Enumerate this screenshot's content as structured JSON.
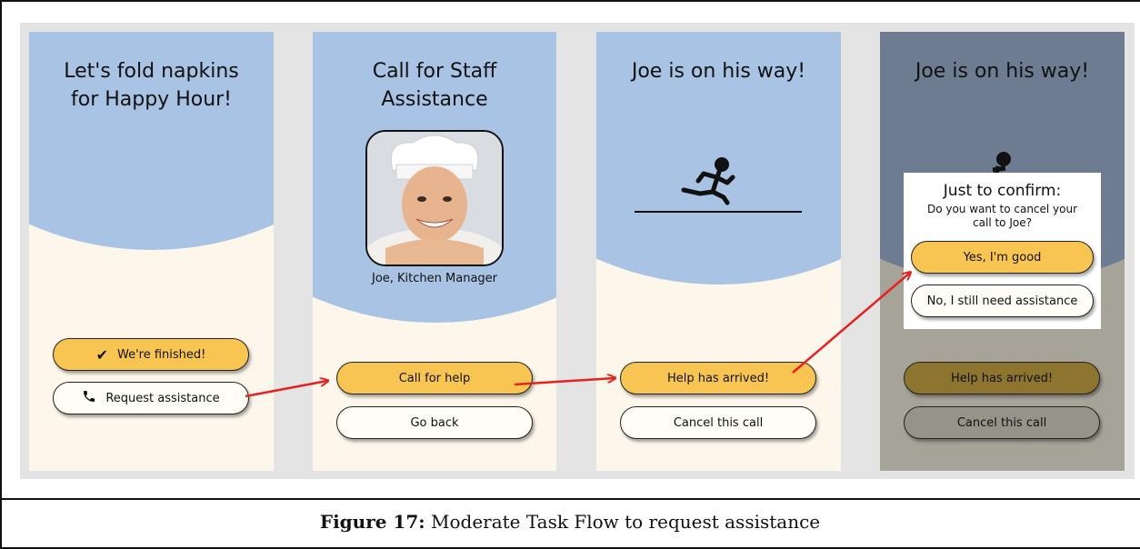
{
  "caption": {
    "label": "Figure 17:",
    "text": "Moderate Task Flow to request assistance"
  },
  "screen1": {
    "title_line1": "Let's fold napkins",
    "title_line2": "for Happy Hour!",
    "finished_label": "We're finished!",
    "request_label": "Request assistance"
  },
  "screen2": {
    "title_line1": "Call for Staff",
    "title_line2": "Assistance",
    "staff_name": "Joe, Kitchen Manager",
    "call_label": "Call for help",
    "back_label": "Go back"
  },
  "screen3": {
    "title": "Joe is on his way!",
    "arrived_label": "Help has arrived!",
    "cancel_label": "Cancel this call"
  },
  "screen4": {
    "title": "Joe is on his way!",
    "arrived_label": "Help has arrived!",
    "cancel_label": "Cancel this call",
    "dialog": {
      "heading": "Just to confirm:",
      "line1": "Do you want to cancel your",
      "line2": "call to Joe?",
      "yes_label": "Yes, I'm good",
      "no_label": "No, I still need assistance"
    }
  },
  "colors": {
    "accent": "#f8c552",
    "blue": "#a9c3e4",
    "cream": "#fcf7ea",
    "arrow": "#e52222"
  }
}
